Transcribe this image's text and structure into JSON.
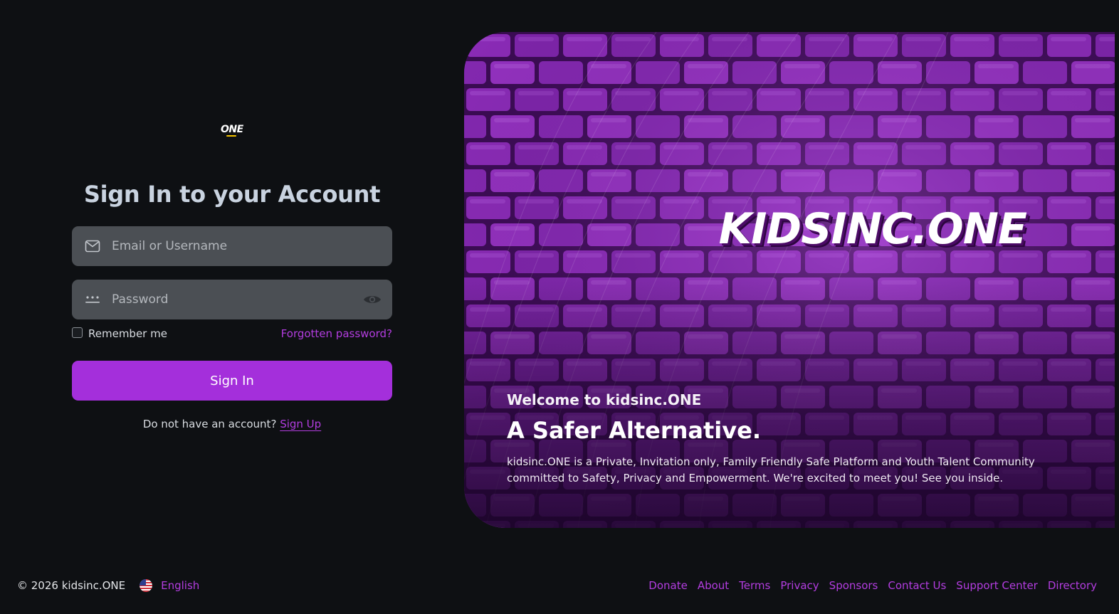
{
  "logo": {
    "text": "ONE"
  },
  "signin": {
    "title": "Sign In to your Account",
    "email_placeholder": "Email or Username",
    "email_value": "",
    "password_placeholder": "Password",
    "password_value": "",
    "remember_label": "Remember me",
    "remember_checked": false,
    "forgot_label": "Forgotten password?",
    "button_label": "Sign In",
    "no_account_text": "Do not have an account?",
    "signup_label": "Sign Up"
  },
  "hero": {
    "brand": "KIDSINC.ONE",
    "welcome": "Welcome to kidsinc.ONE",
    "tagline": "A Safer Alternative.",
    "description": "kidsinc.ONE is a Private, Invitation only, Family Friendly Safe Platform and Youth Talent Community committed to Safety, Privacy and Empowerment. We're excited to meet you! See you inside."
  },
  "footer": {
    "copyright": "© 2026 kidsinc.ONE",
    "language": "English",
    "links": [
      "Donate",
      "About",
      "Terms",
      "Privacy",
      "Sponsors",
      "Contact Us",
      "Support Center",
      "Directory"
    ]
  },
  "colors": {
    "background": "#0e1013",
    "accent": "#a42fdb",
    "link": "#b33de0",
    "input_bg": "#4b4f54",
    "hero_brick": "#7b24a3"
  },
  "icons": {
    "email": "envelope-icon",
    "password": "dots-icon",
    "toggle": "eye-icon",
    "language": "us-flag-icon"
  }
}
